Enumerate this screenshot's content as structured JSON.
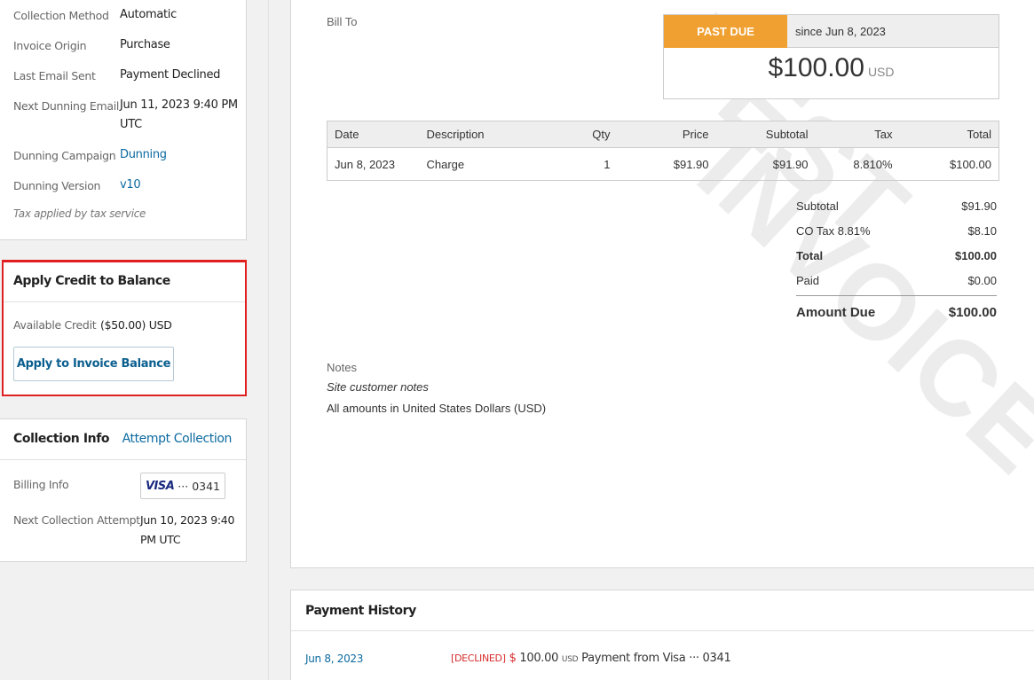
{
  "invoice_details": {
    "rows": [
      {
        "label": "Collection Method",
        "value": "Automatic"
      },
      {
        "label": "Invoice Origin",
        "value": "Purchase"
      },
      {
        "label": "Last Email Sent",
        "value": "Payment Declined"
      },
      {
        "label": "Next Dunning Email",
        "value": "Jun 11, 2023 9:40 PM UTC"
      },
      {
        "label": "Dunning Campaign",
        "value": "Dunning"
      },
      {
        "label": "Dunning Version",
        "value": "v10"
      }
    ],
    "tax_note": "Tax applied by tax service"
  },
  "apply_credit": {
    "title": "Apply Credit to Balance",
    "available_label": "Available Credit",
    "available_value": "($50.00) USD",
    "button_label": "Apply to Invoice Balance"
  },
  "collection_info": {
    "title": "Collection Info",
    "attempt_label": "Attempt Collection",
    "billing_label": "Billing Info",
    "card_brand": "VISA",
    "card_last4": "··· 0341",
    "next_label": "Next Collection Attempt",
    "next_value": "Jun 10, 2023 9:40 PM UTC"
  },
  "invoice": {
    "watermark_line1": "TEST",
    "watermark_line2": "INVOICE",
    "bill_to_label": "Bill To",
    "status": "PAST DUE",
    "since": "since Jun 8, 2023",
    "amount": "$100.00",
    "currency": "USD",
    "table_headers": [
      "Date",
      "Description",
      "Qty",
      "Price",
      "Subtotal",
      "Tax",
      "Total"
    ],
    "line_items": [
      {
        "date": "Jun 8, 2023",
        "description": "Charge",
        "qty": "1",
        "price": "$91.90",
        "subtotal": "$91.90",
        "tax": "8.810%",
        "total": "$100.00"
      }
    ],
    "totals": {
      "subtotal_label": "Subtotal",
      "subtotal": "$91.90",
      "tax_label": "CO Tax 8.81%",
      "tax": "$8.10",
      "total_label": "Total",
      "total": "$100.00",
      "paid_label": "Paid",
      "paid": "$0.00",
      "due_label": "Amount Due",
      "due": "$100.00"
    },
    "notes_label": "Notes",
    "notes_text": "Site customer notes",
    "amounts_note": "All amounts in United States Dollars (USD)"
  },
  "payment_history": {
    "title": "Payment History",
    "rows": [
      {
        "date": "Jun 8, 2023",
        "status": "[DECLINED]",
        "symbol": "$",
        "amount": "100.00",
        "currency": "USD",
        "description": "Payment from Visa ··· 0341"
      }
    ]
  },
  "colors": {
    "past_due": "#f0a030",
    "link": "#0b6aa0",
    "highlight": "#e02020",
    "declined": "#d62b2b"
  }
}
